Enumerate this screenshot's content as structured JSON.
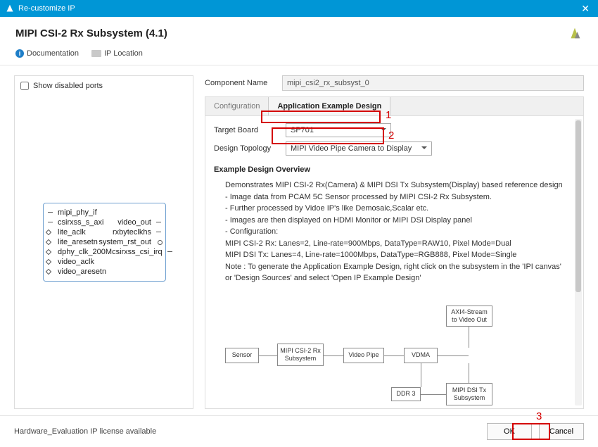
{
  "titlebar": {
    "title": "Re-customize IP"
  },
  "header": {
    "title": "MIPI CSI-2 Rx Subsystem (4.1)"
  },
  "toolbar": {
    "documentation": "Documentation",
    "ip_location": "IP Location"
  },
  "left": {
    "show_disabled": "Show disabled ports",
    "ports_left": [
      "mipi_phy_if",
      "csirxss_s_axi",
      "lite_aclk",
      "lite_aresetn",
      "dphy_clk_200M",
      "video_aclk",
      "video_aresetn"
    ],
    "ports_right": [
      "video_out",
      "rxbyteclkhs",
      "system_rst_out",
      "csirxss_csi_irq"
    ]
  },
  "right": {
    "component_name_label": "Component Name",
    "component_name_value": "mipi_csi2_rx_subsyst_0",
    "tabs": [
      "Configuration",
      "Application Example Design"
    ],
    "active_tab": 1,
    "target_board_label": "Target Board",
    "target_board_value": "SP701",
    "design_topology_label": "Design Topology",
    "design_topology_value": "MIPI Video Pipe Camera to Display",
    "overview_title": "Example Design Overview",
    "overview_lines": [
      "Demonstrates MIPI CSI-2 Rx(Camera) & MIPI DSI Tx Subsystem(Display) based reference design",
      "- Image data from PCAM 5C Sensor processed by MIPI CSI-2 Rx Subsystem.",
      "- Further processed by Vidoe IP's like Demosaic,Scalar etc.",
      "- Images are then displayed on HDMI Monitor or MIPI DSI Display panel",
      "",
      "- Configuration:",
      "MIPI CSI-2 Rx: Lanes=2, Line-rate=900Mbps, DataType=RAW10, Pixel Mode=Dual",
      "MIPI DSI Tx: Lanes=4, Line-rate=1000Mbps, DataType=RGB888, Pixel Mode=Single",
      "",
      "Note : To generate the Application Example Design, right click on the subsystem in the 'IPI canvas'",
      "or 'Design Sources' and select 'Open IP Example Design'"
    ],
    "diagram": {
      "sensor": "Sensor",
      "csi_rx": "MIPI CSI-2 Rx\nSubsystem",
      "video_pipe": "Video Pipe",
      "vdma": "VDMA",
      "axi_stream": "AXI4-Stream\nto Video Out",
      "ddr": "DDR 3",
      "dsi_tx": "MIPI DSI Tx\nSubsystem"
    }
  },
  "footer": {
    "status": "Hardware_Evaluation IP license available",
    "ok": "OK",
    "cancel": "Cancel"
  },
  "annotations": {
    "one": "1",
    "two": "2",
    "three": "3"
  }
}
